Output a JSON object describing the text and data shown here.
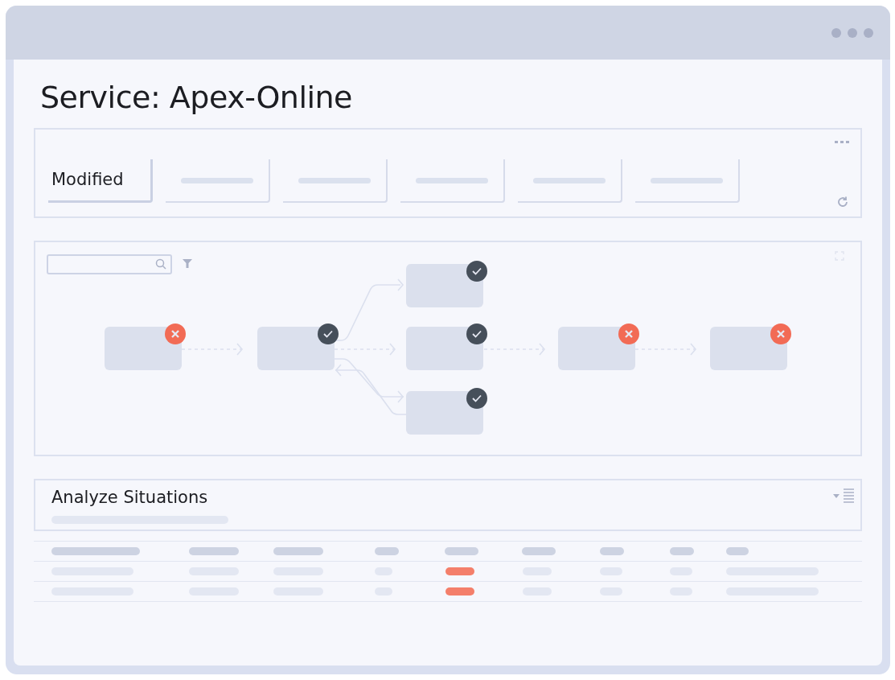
{
  "window": {
    "title": "Service: Apex-Online"
  },
  "tabs": [
    {
      "label": "Modified",
      "selected": true
    },
    {
      "selected": false
    },
    {
      "selected": false
    },
    {
      "selected": false
    },
    {
      "selected": false
    },
    {
      "selected": false
    }
  ],
  "diagram": {
    "nodes": [
      {
        "passed": false
      },
      {
        "passed": true
      },
      {
        "passed": true
      },
      {
        "passed": true
      },
      {
        "passed": true
      },
      {
        "passed": false
      },
      {
        "passed": false
      }
    ]
  },
  "analysis": {
    "title": "Analyze Situations"
  },
  "table": {
    "rows": [
      {
        "alert": true
      },
      {
        "alert": true
      }
    ]
  }
}
